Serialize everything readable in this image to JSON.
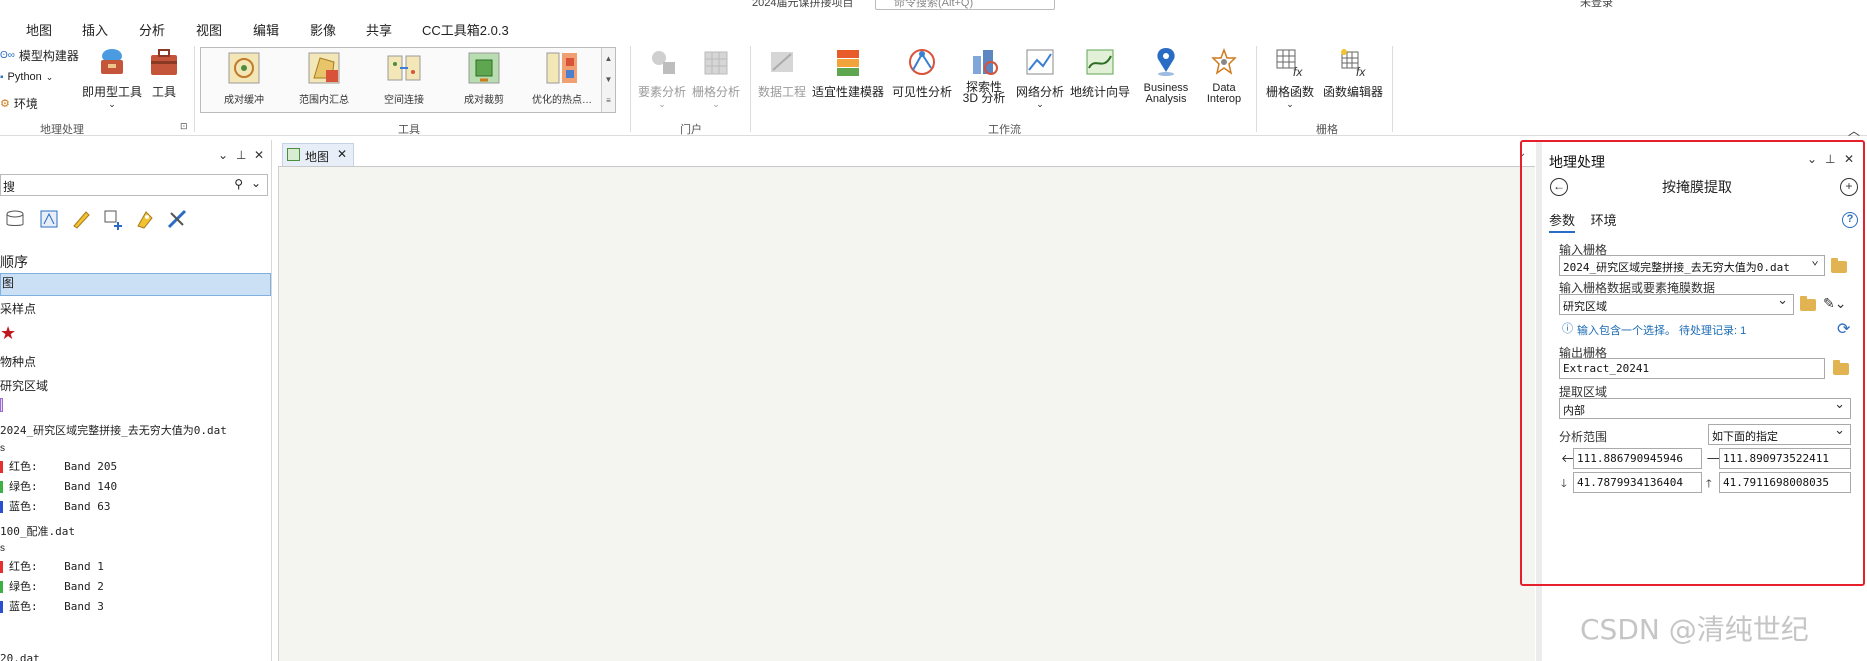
{
  "window": {
    "title": "2024届元谋拼接项目",
    "search_placeholder": "命令搜索(Alt+Q)",
    "user": "未登录"
  },
  "menu_tabs": [
    "地图",
    "插入",
    "分析",
    "视图",
    "编辑",
    "影像",
    "共享",
    "CC工具箱2.0.3"
  ],
  "active_menu_tab": "分析",
  "ribbon": {
    "geoprocessing": {
      "model_builder": "模型构建器",
      "python": "Python",
      "environments": "环境",
      "ready_to_use": "即用型工具",
      "tools": "工具",
      "group_label": "地理处理"
    },
    "tools_gallery": {
      "items": [
        "成对缓冲",
        "范围内汇总",
        "空间连接",
        "成对裁剪",
        "优化的热点…"
      ],
      "group_label": "工具"
    },
    "portal": {
      "feature_analysis": "要素分析",
      "raster_analysis": "栅格分析",
      "group_label": "门户"
    },
    "workflows": {
      "data_engineering": "数据工程",
      "suitability_modeler": "适宜性建模器",
      "visibility_analysis": "可见性分析",
      "exploratory_3d": "探索性\n3D 分析",
      "network_analysis": "网络分析",
      "geostatistical_wizard": "地统计向导",
      "business_analysis": "Business\nAnalysis",
      "data_interop": "Data\nInterop",
      "group_label": "工作流"
    },
    "raster": {
      "raster_functions": "栅格函数",
      "function_editor": "函数编辑器",
      "group_label": "栅格"
    }
  },
  "contents": {
    "search_value": "搜",
    "drawing_order": "顺序",
    "items": [
      {
        "label": "图",
        "selected": true
      },
      {
        "label": "采样点"
      },
      {
        "label": "物种点"
      },
      {
        "label": "研究区域"
      },
      {
        "label": "2024_研究区域完整拼接_去无穷大值为0.dat"
      },
      {
        "label": "红色:    Band 205",
        "color": "#e53030"
      },
      {
        "label": "绿色:    Band 140",
        "color": "#3cb043"
      },
      {
        "label": "蓝色:    Band 63",
        "color": "#2a4fd0"
      },
      {
        "label": "100_配准.dat"
      },
      {
        "label": "红色:    Band 1",
        "color": "#e53030"
      },
      {
        "label": "绿色:    Band 2",
        "color": "#3cb043"
      },
      {
        "label": "蓝色:    Band 3",
        "color": "#2a4fd0"
      },
      {
        "label": "20.dat"
      }
    ]
  },
  "map_view": {
    "tab_label": "地图"
  },
  "geoprocessing_pane": {
    "title": "地理处理",
    "tool_name": "按掩膜提取",
    "tabs": [
      "参数",
      "环境"
    ],
    "active_tab": "参数",
    "input_raster_label": "输入栅格",
    "input_raster_value": "2024_研究区域完整拼接_去无穷大值为0.dat",
    "mask_label": "输入栅格数据或要素掩膜数据",
    "mask_value": "研究区域",
    "selection_info": "输入包含一个选择。 待处理记录: 1",
    "output_label": "输出栅格",
    "output_value": "Extract_20241",
    "extraction_area_label": "提取区域",
    "extraction_area_value": "内部",
    "analysis_extent_label": "分析范围",
    "analysis_extent_value": "如下面的指定",
    "extent": {
      "left": "111.886790945946",
      "right": "111.890973522411",
      "bottom": "41.7879934136404",
      "top": "41.7911698008035"
    }
  },
  "watermark": "CSDN @清纯世纪",
  "colors": {
    "accent": "#2a6cc4",
    "highlight_box": "#e5202a",
    "selection": "#cce0f5"
  }
}
